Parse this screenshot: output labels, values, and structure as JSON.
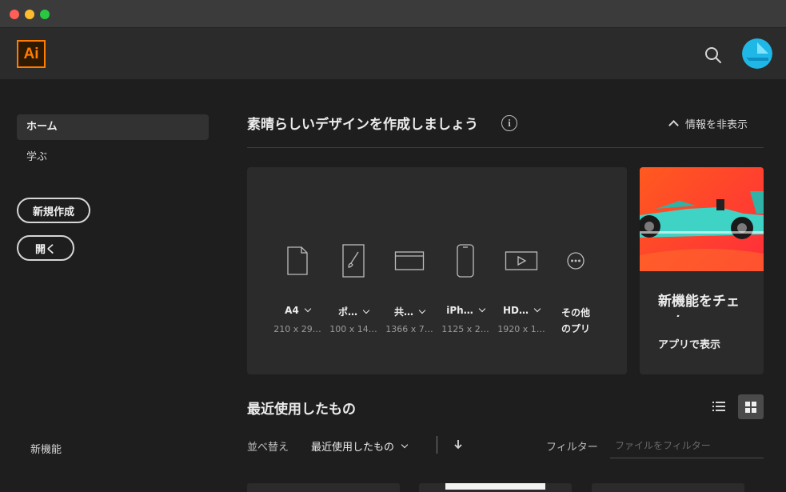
{
  "window": {
    "title_bar_buttons": [
      "close",
      "minimize",
      "zoom"
    ]
  },
  "header": {
    "logo_text": "Ai",
    "icons": [
      "search-icon",
      "avatar"
    ]
  },
  "sidebar": {
    "items": [
      {
        "label": "ホーム",
        "selected": true
      },
      {
        "label": "学ぶ",
        "selected": false
      }
    ],
    "new_button": "新規作成",
    "open_button": "開く",
    "new_features": "新機能"
  },
  "hero": {
    "title": "素晴らしいデザインを作成しましょう",
    "info_icon": "i",
    "hide_info_label": "情報を非表示"
  },
  "presets": [
    {
      "icon": "document-icon",
      "name": "A4",
      "size": "210 x 29…",
      "has_dropdown": true
    },
    {
      "icon": "brush-icon",
      "name": "ポ…",
      "size": "100 x 14…",
      "has_dropdown": true
    },
    {
      "icon": "web-icon",
      "name": "共…",
      "size": "1366 x 7…",
      "has_dropdown": true
    },
    {
      "icon": "phone-icon",
      "name": "iPh…",
      "size": "1125 x 2…",
      "has_dropdown": true
    },
    {
      "icon": "video-icon",
      "name": "HD…",
      "size": "1920 x 1…",
      "has_dropdown": true
    },
    {
      "icon": "more-icon",
      "name_line1": "その他",
      "name_line2": "のプリ",
      "has_dropdown": false
    }
  ],
  "promo": {
    "title": "新機能をチェック",
    "link": "アプリで表示"
  },
  "recent": {
    "title": "最近使用したもの",
    "sort_label": "並べ替え",
    "sort_value": "最近使用したもの",
    "filter_label": "フィルター",
    "filter_placeholder": "ファイルをフィルター",
    "filter_value": "",
    "view_mode": "grid"
  },
  "colors": {
    "accent_logo": "#ff7c00",
    "titlebar": "#3b3b3b",
    "header": "#2b2b2b",
    "background": "#1e1e1e",
    "panel": "#2b2b2b",
    "promo_bg": "#ff4a2a"
  }
}
